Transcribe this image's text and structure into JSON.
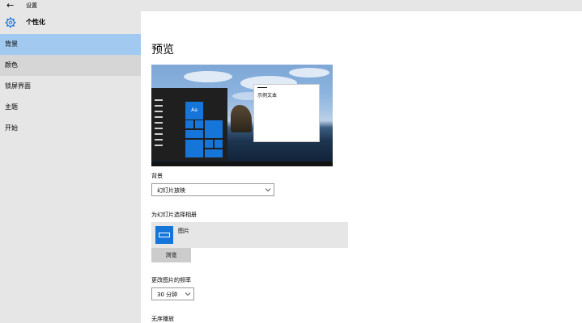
{
  "window": {
    "back_glyph": "←",
    "title": "设置"
  },
  "sidebar": {
    "section_title": "个性化",
    "items": [
      {
        "label": "背景",
        "state": "selected"
      },
      {
        "label": "颜色",
        "state": "hover"
      },
      {
        "label": "锁屏界面",
        "state": "normal"
      },
      {
        "label": "主题",
        "state": "normal"
      },
      {
        "label": "开始",
        "state": "normal"
      }
    ]
  },
  "main": {
    "title": "预览",
    "preview": {
      "tile_label": "Aa",
      "sample_text": "示例文本"
    },
    "background": {
      "label": "背景",
      "value": "幻灯片放映"
    },
    "album": {
      "label": "为幻灯片选择相册",
      "name": "图片",
      "browse_label": "浏览"
    },
    "frequency": {
      "label": "更改图片的频率",
      "value": "30 分钟"
    },
    "shuffle": {
      "label": "无序播放"
    }
  },
  "colors": {
    "accent": "#1575d9",
    "selected": "#a2c9ef",
    "sidebar_bg": "#e6e6e6"
  }
}
